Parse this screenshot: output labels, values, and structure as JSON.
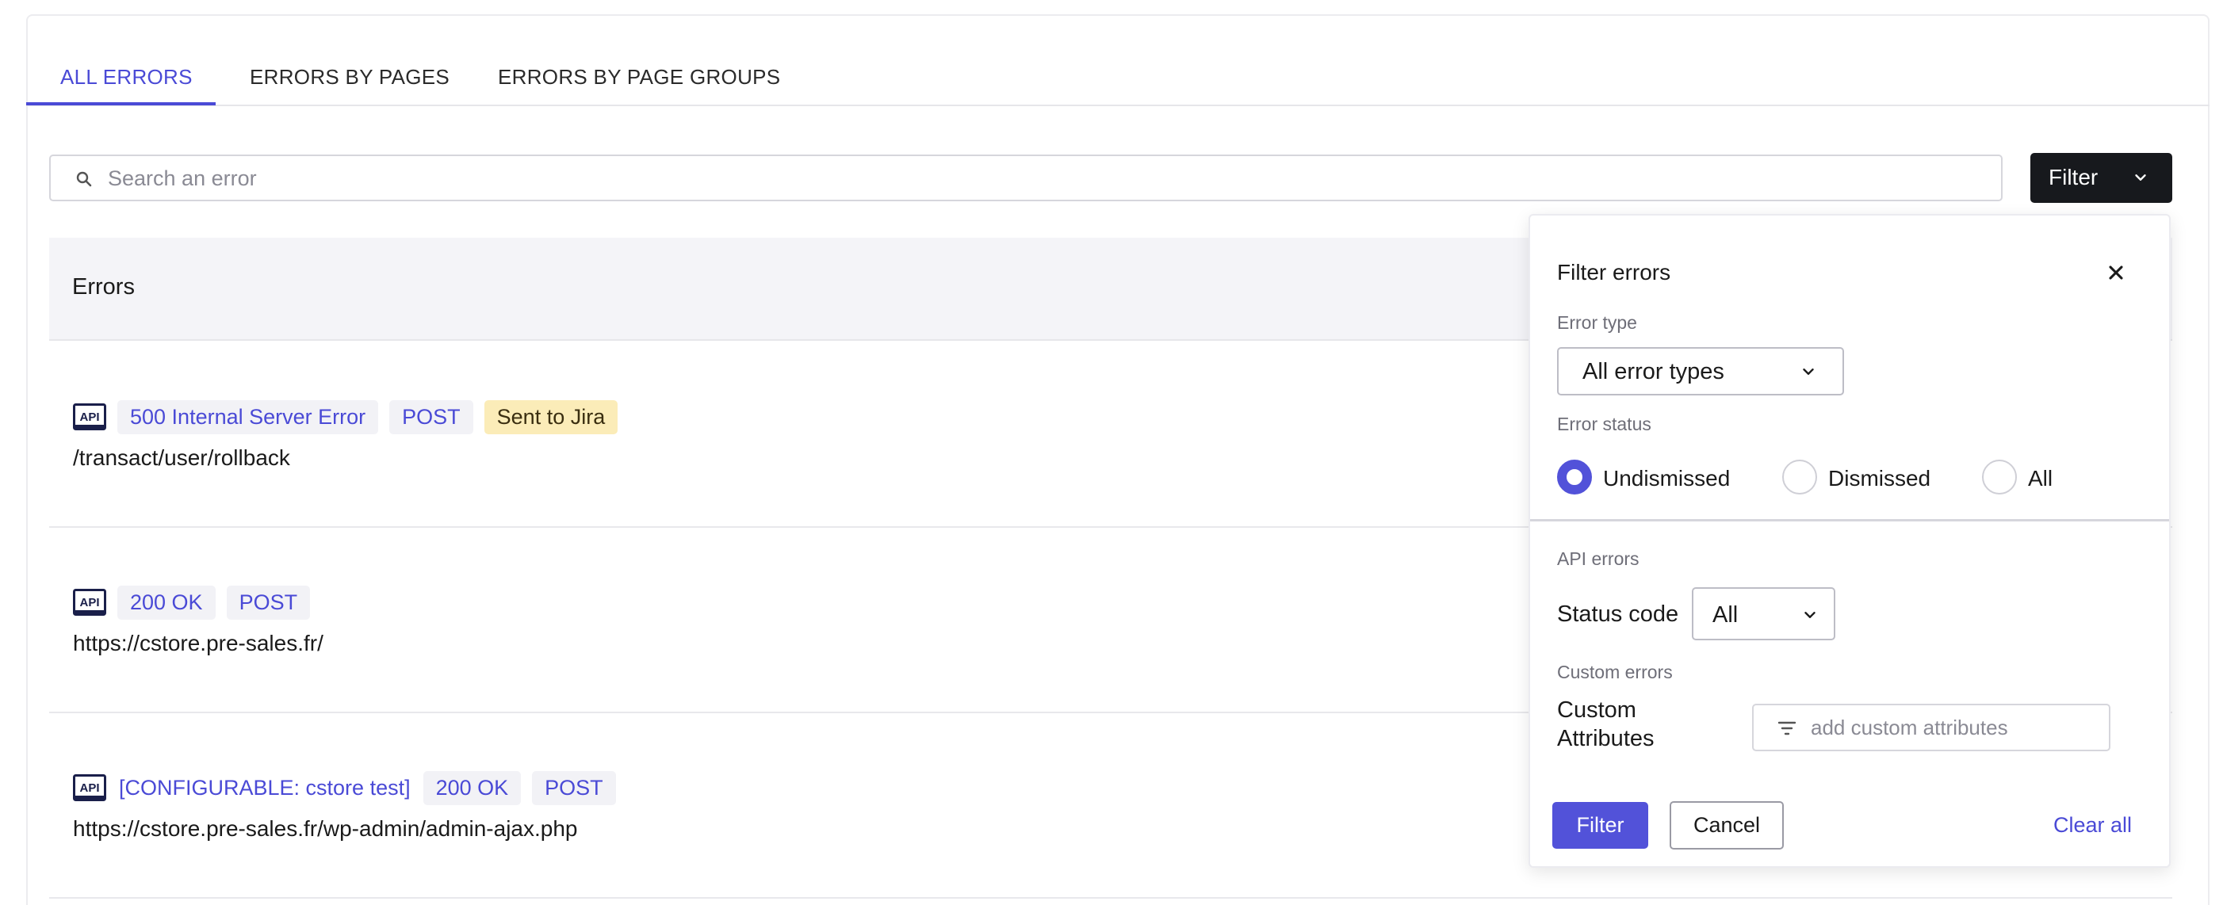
{
  "tabs": [
    {
      "label": "ALL ERRORS",
      "active": true
    },
    {
      "label": "ERRORS BY PAGES",
      "active": false
    },
    {
      "label": "ERRORS BY PAGE GROUPS",
      "active": false
    }
  ],
  "search": {
    "placeholder": "Search an error",
    "icon": "search-icon"
  },
  "filter_button": {
    "label": "Filter",
    "icon": "chevron-down-icon"
  },
  "table": {
    "header": "Errors",
    "rows": [
      {
        "icon": "api-icon",
        "tags": [
          "500 Internal Server Error",
          "POST"
        ],
        "jira": "Sent to Jira",
        "path": "/transact/user/rollback"
      },
      {
        "icon": "api-icon",
        "tags": [
          "200 OK",
          "POST"
        ],
        "path": "https://cstore.pre-sales.fr/"
      },
      {
        "icon": "api-icon",
        "custom_label": "[CONFIGURABLE: cstore test]",
        "tags": [
          "200 OK",
          "POST"
        ],
        "path": "https://cstore.pre-sales.fr/wp-admin/admin-ajax.php"
      }
    ]
  },
  "filter_panel": {
    "title": "Filter errors",
    "close_icon": "close-icon",
    "error_type": {
      "label": "Error type",
      "value": "All error types"
    },
    "error_status": {
      "label": "Error status",
      "options": [
        {
          "label": "Undismissed",
          "checked": true
        },
        {
          "label": "Dismissed",
          "checked": false
        },
        {
          "label": "All",
          "checked": false
        }
      ]
    },
    "api_errors": {
      "label": "API errors",
      "status_code_label": "Status code",
      "status_code_value": "All"
    },
    "custom_errors": {
      "label": "Custom errors",
      "attributes_label_line1": "Custom",
      "attributes_label_line2": "Attributes",
      "attributes_placeholder": "add custom attributes"
    },
    "actions": {
      "apply": "Filter",
      "cancel": "Cancel",
      "clear": "Clear all"
    }
  },
  "colors": {
    "accent": "#5252d9",
    "link": "#4a4ad6",
    "dark_button": "#17191d",
    "jira_badge": "#fbecb8"
  }
}
